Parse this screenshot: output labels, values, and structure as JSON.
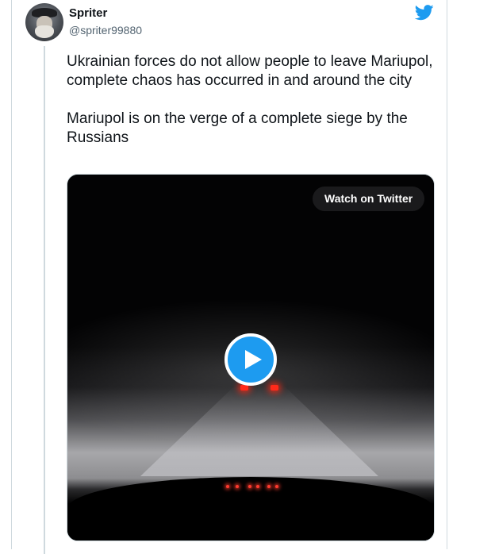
{
  "author": {
    "name": "Spriter",
    "handle": "@spriter99880"
  },
  "tweet": {
    "paragraphs": [
      "Ukrainian forces do not allow people to leave Mariupol, complete chaos has occurred in and around the city",
      "Mariupol is on the verge of a complete siege by the Russians"
    ]
  },
  "video": {
    "watch_label": "Watch on Twitter"
  },
  "colors": {
    "brand": "#1d9bf0",
    "text": "#0f1419",
    "secondary_text": "#536471"
  },
  "icons": {
    "brand": "twitter-bird-icon",
    "play": "play-icon"
  }
}
